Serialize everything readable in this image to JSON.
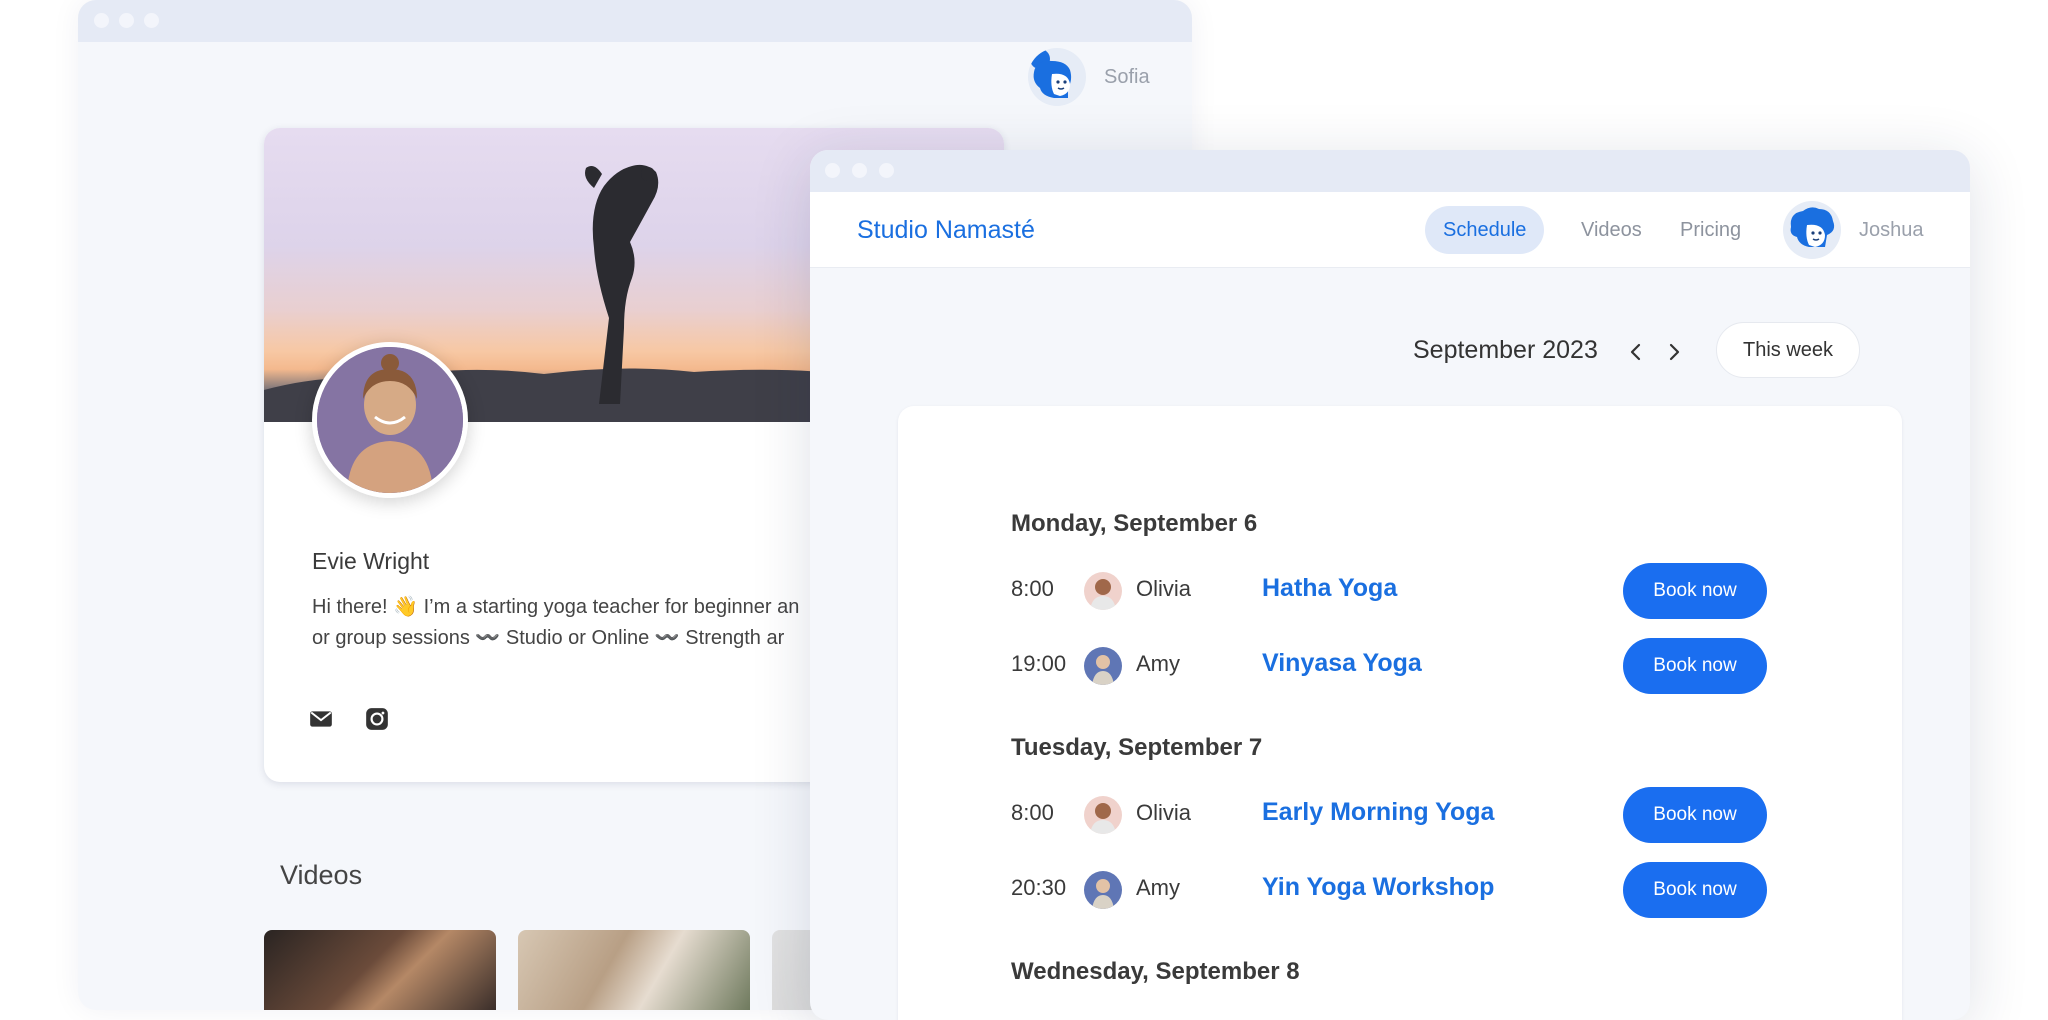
{
  "profile_window": {
    "user_name": "Sofia",
    "profile": {
      "name": "Evie Wright",
      "bio_line1": "Hi there! 👋 I’m a starting yoga teacher for beginner an",
      "bio_line2": "or group sessions 〰️ Studio or Online 〰️ Strength ar",
      "social_icons": [
        "mail-icon",
        "instagram-icon"
      ]
    },
    "videos_title": "Videos"
  },
  "studio_window": {
    "brand": "Studio Namasté",
    "nav": [
      {
        "label": "Schedule",
        "active": true
      },
      {
        "label": "Videos",
        "active": false
      },
      {
        "label": "Pricing",
        "active": false
      }
    ],
    "user_name": "Joshua",
    "month_label": "September 2023",
    "this_week_label": "This week",
    "days": [
      {
        "heading": "Monday, September 6",
        "slots": [
          {
            "time": "8:00",
            "teacher": "Olivia",
            "class": "Hatha Yoga",
            "button": "Book now"
          },
          {
            "time": "19:00",
            "teacher": "Amy",
            "class": "Vinyasa Yoga",
            "button": "Book now"
          }
        ]
      },
      {
        "heading": "Tuesday, September 7",
        "slots": [
          {
            "time": "8:00",
            "teacher": "Olivia",
            "class": "Early Morning Yoga",
            "button": "Book now"
          },
          {
            "time": "20:30",
            "teacher": "Amy",
            "class": "Yin Yoga Workshop",
            "button": "Book now"
          }
        ]
      },
      {
        "heading": "Wednesday, September 8",
        "slots": []
      }
    ]
  },
  "colors": {
    "accent": "#1a6fe0",
    "button": "#1a6ef0",
    "titlebar": "#e5eaf5",
    "window_bg": "#f5f7fb"
  }
}
